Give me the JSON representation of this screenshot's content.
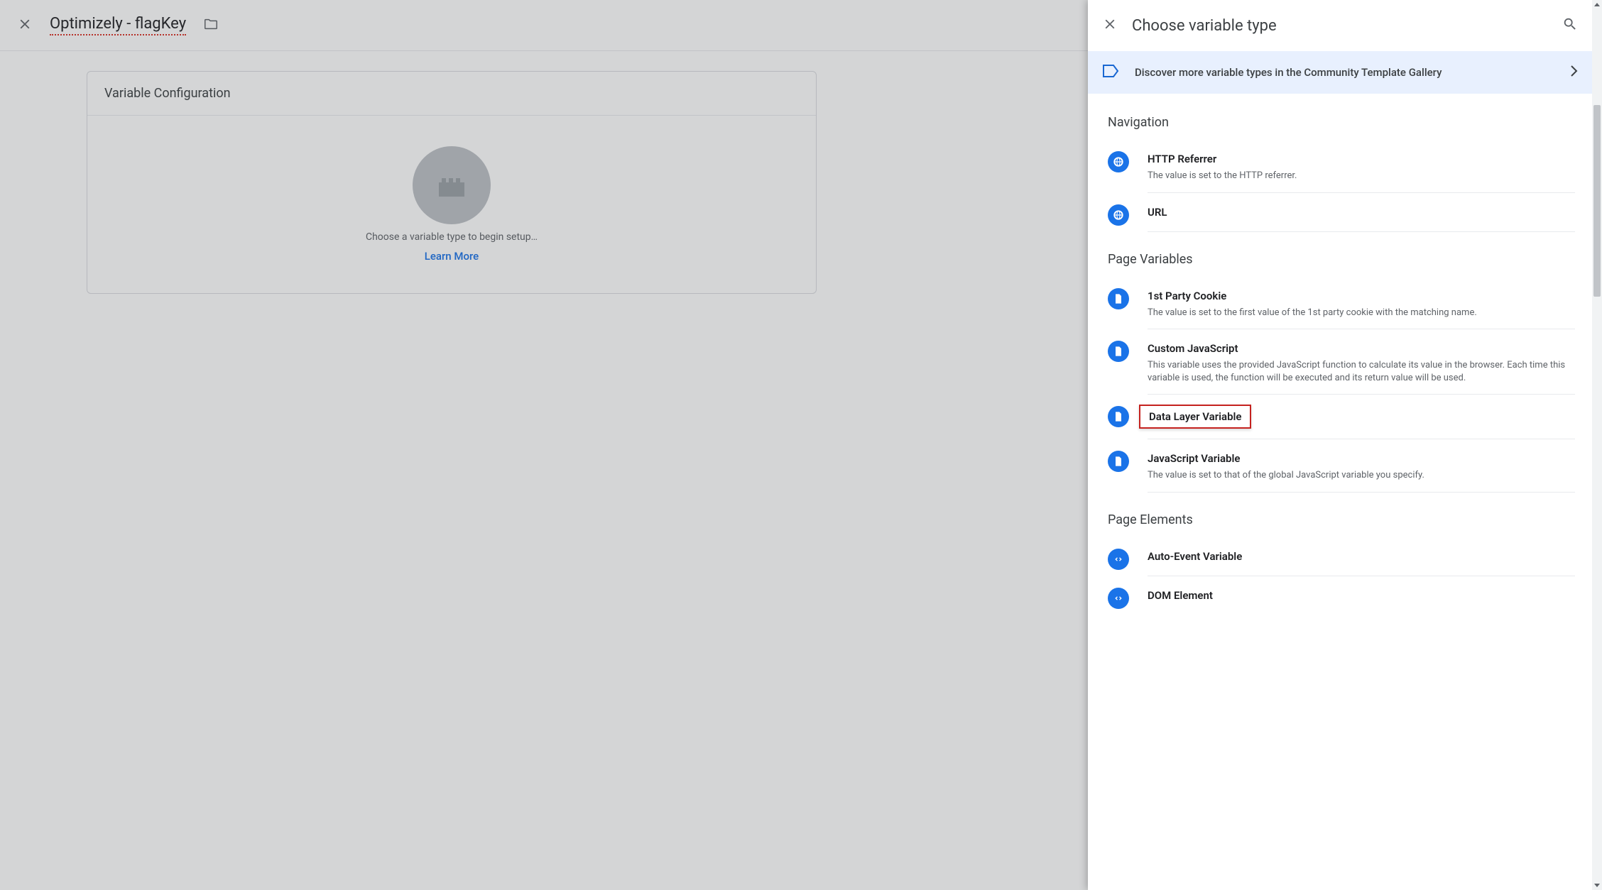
{
  "editor": {
    "variable_name": "Optimizely - flagKey",
    "card_title": "Variable Configuration",
    "config_hint": "Choose a variable type to begin setup…",
    "learn_more": "Learn More"
  },
  "drawer": {
    "title": "Choose variable type",
    "discover_text": "Discover more variable types in the Community Template Gallery",
    "sections": {
      "navigation": {
        "title": "Navigation",
        "http_referrer": {
          "title": "HTTP Referrer",
          "desc": "The value is set to the HTTP referrer."
        },
        "url": {
          "title": "URL"
        }
      },
      "page_variables": {
        "title": "Page Variables",
        "first_party_cookie": {
          "title": "1st Party Cookie",
          "desc": "The value is set to the first value of the 1st party cookie with the matching name."
        },
        "custom_js": {
          "title": "Custom JavaScript",
          "desc": "This variable uses the provided JavaScript function to calculate its value in the browser. Each time this variable is used, the function will be executed and its return value will be used."
        },
        "data_layer": {
          "title": "Data Layer Variable"
        },
        "js_variable": {
          "title": "JavaScript Variable",
          "desc": "The value is set to that of the global JavaScript variable you specify."
        }
      },
      "page_elements": {
        "title": "Page Elements",
        "auto_event": {
          "title": "Auto-Event Variable"
        },
        "dom_element": {
          "title": "DOM Element"
        }
      }
    }
  }
}
